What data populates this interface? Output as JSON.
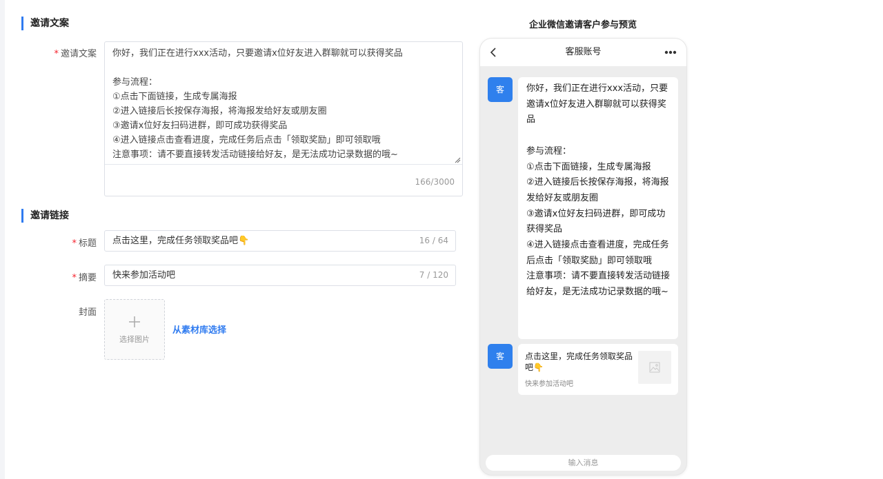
{
  "sections": {
    "copy_title": "邀请文案",
    "link_title": "邀请链接"
  },
  "form": {
    "copy_label": "邀请文案",
    "copy_text": "你好，我们正在进行xxx活动，只要邀请x位好友进入群聊就可以获得奖品\n\n参与流程：\n①点击下面链接，生成专属海报\n②进入链接后长按保存海报，将海报发给好友或朋友圈\n③邀请x位好友扫码进群，即可成功获得奖品\n④进入链接点击查看进度，完成任务后点击「领取奖励」即可领取哦\n注意事项：请不要直接转发活动链接给好友，是无法成功记录数据的哦~",
    "copy_counter": "166/3000",
    "title_label": "标题",
    "title_value": "点击这里，完成任务领取奖品吧👇",
    "title_counter": "16 / 64",
    "summary_label": "摘要",
    "summary_value": "快来参加活动吧",
    "summary_counter": "7 / 120",
    "cover_label": "封面",
    "cover_upload_text": "选择图片",
    "cover_library_link": "从素材库选择",
    "required_mark": "*"
  },
  "preview": {
    "title": "企业微信邀请客户参与预览",
    "phone_title": "客服账号",
    "avatar_text": "客",
    "message_text": "你好，我们正在进行xxx活动，只要邀请x位好友进入群聊就可以获得奖品\n\n参与流程：\n①点击下面链接，生成专属海报\n②进入链接后长按保存海报，将海报发给好友或朋友圈\n③邀请x位好友扫码进群，即可成功获得奖品\n④进入链接点击查看进度，完成任务后点击「领取奖励」即可领取哦\n注意事项：请不要直接转发活动链接给好友，是无法成功记录数据的哦~",
    "card_title": "点击这里，完成任务领取奖品吧👇",
    "card_desc": "快来参加活动吧",
    "input_placeholder": "输入消息"
  },
  "colors": {
    "accent": "#2f7bf0",
    "avatar": "#2f80ed",
    "required": "#f5222d"
  }
}
